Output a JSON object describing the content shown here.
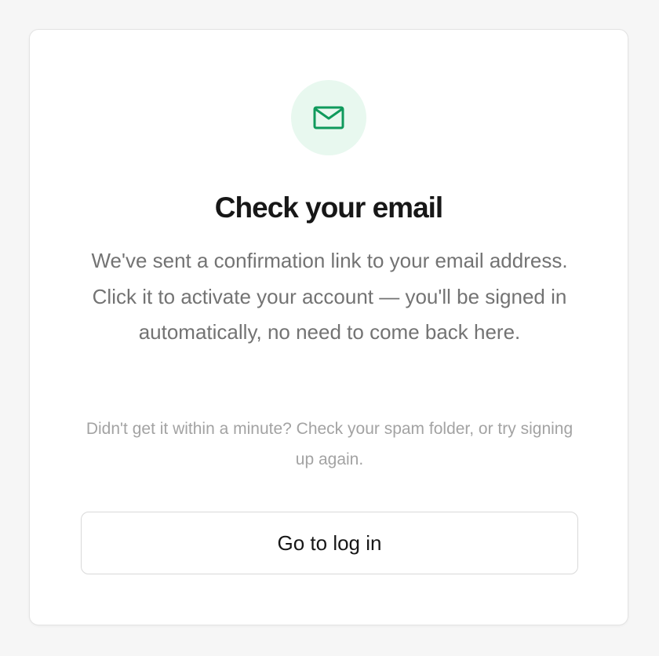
{
  "confirmation": {
    "icon": "mail-icon",
    "accent_color": "#0f9a5c",
    "icon_bg_color": "#e8f8ef",
    "title": "Check your email",
    "message": "We've sent a confirmation link to your email address. Click it to activate your account — you'll be signed in automatically, no need to come back here.",
    "hint": "Didn't get it within a minute? Check your spam folder, or try signing up again.",
    "login_button_label": "Go to log in"
  }
}
